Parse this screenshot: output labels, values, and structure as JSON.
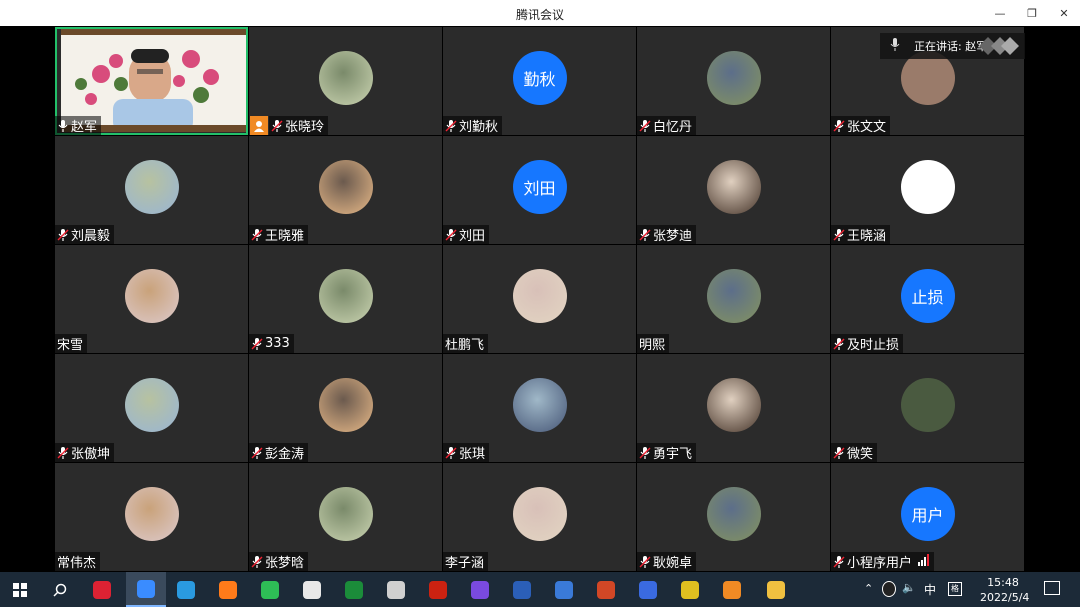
{
  "window": {
    "title": "腾讯会议"
  },
  "speaking": {
    "label": "正在讲话: 赵军;"
  },
  "colors": {
    "accent": "#1677ff",
    "active_border": "#23c06a",
    "tile_bg": "#2b2b2b",
    "taskbar": "#1c2a38"
  },
  "participants": [
    {
      "name": "赵军",
      "mic": true,
      "active": true,
      "avatar": "video"
    },
    {
      "name": "张晓玲",
      "mic": true,
      "host": true,
      "avatar": "photo"
    },
    {
      "name": "刘勤秋",
      "mic": true,
      "avatar_text": "勤秋"
    },
    {
      "name": "白忆丹",
      "mic": true,
      "avatar": "photo"
    },
    {
      "name": "张文文",
      "mic": true,
      "avatar": "photo"
    },
    {
      "name": "刘晨毅",
      "mic": true,
      "avatar": "photo"
    },
    {
      "name": "王晓雅",
      "mic": true,
      "avatar": "photo"
    },
    {
      "name": "刘田",
      "mic": true,
      "avatar_text": "刘田"
    },
    {
      "name": "张梦迪",
      "mic": true,
      "avatar": "photo"
    },
    {
      "name": "王晓涵",
      "mic": true,
      "avatar": "white"
    },
    {
      "name": "宋雪",
      "mic": false,
      "avatar": "photo"
    },
    {
      "name": "333",
      "mic": true,
      "avatar": "photo"
    },
    {
      "name": "杜鹏飞",
      "mic": false,
      "avatar": "photo"
    },
    {
      "name": "明熙",
      "mic": false,
      "avatar": "photo"
    },
    {
      "name": "及时止损",
      "mic": true,
      "avatar_text": "止损"
    },
    {
      "name": "张傲坤",
      "mic": true,
      "avatar": "photo"
    },
    {
      "name": "彭金涛",
      "mic": true,
      "avatar": "photo"
    },
    {
      "name": "张琪",
      "mic": true,
      "avatar": "photo"
    },
    {
      "name": "勇宇飞",
      "mic": true,
      "avatar": "photo"
    },
    {
      "name": "微笑",
      "mic": true,
      "avatar": "photo"
    },
    {
      "name": "常伟杰",
      "mic": false,
      "avatar": "photo"
    },
    {
      "name": "张梦晗",
      "mic": true,
      "avatar": "photo"
    },
    {
      "name": "李子涵",
      "mic": false,
      "avatar": "photo"
    },
    {
      "name": "耿婉卓",
      "mic": true,
      "avatar": "photo"
    },
    {
      "name": "小程序用户",
      "mic": true,
      "avatar_text": "用户",
      "signal": true
    }
  ],
  "taskbar": {
    "icons": [
      "windows-start-icon",
      "search-icon",
      "qq-icon",
      "tencent-meeting-icon",
      "photos-icon",
      "firefox-icon",
      "wechat-icon",
      "pdf-reader-icon",
      "code-editor-icon",
      "solitaire-icon",
      "acrobat-icon",
      "chart-app-icon",
      "word-icon",
      "network-app-icon",
      "powerpoint-icon",
      "package-icon",
      "security-shield-icon",
      "search-tool-icon",
      "file-explorer-icon"
    ],
    "ime": "中",
    "time": "15:48",
    "date": "2022/5/4"
  }
}
